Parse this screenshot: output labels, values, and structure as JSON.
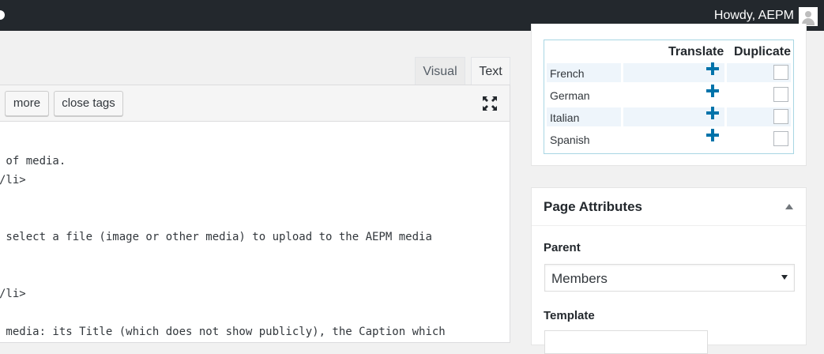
{
  "admin_bar": {
    "greeting": "Howdy, AEPM"
  },
  "editor": {
    "tabs": [
      {
        "label": "Visual"
      },
      {
        "label": "Text"
      }
    ],
    "quicktags": [
      {
        "label": "more"
      },
      {
        "label": "close tags"
      }
    ],
    "lines": [
      " of media.",
      "/li>",
      " select a file (image or other media) to upload to the AEPM media",
      "/li>",
      " media: its Title (which does not show publicly), the Caption which"
    ]
  },
  "translation": {
    "headers": {
      "translate": "Translate",
      "duplicate": "Duplicate"
    },
    "languages": [
      {
        "name": "French"
      },
      {
        "name": "German"
      },
      {
        "name": "Italian"
      },
      {
        "name": "Spanish"
      }
    ]
  },
  "page_attributes": {
    "title": "Page Attributes",
    "parent_label": "Parent",
    "parent_value": "Members",
    "template_label": "Template"
  },
  "icons": {
    "fullscreen": "fullscreen-icon",
    "add": "plus-icon",
    "collapse": "triangle-up-icon",
    "avatar": "avatar-icon"
  },
  "colors": {
    "admin_bar": "#23282d",
    "accent": "#0073aa",
    "table_border": "#a8d6e3"
  }
}
